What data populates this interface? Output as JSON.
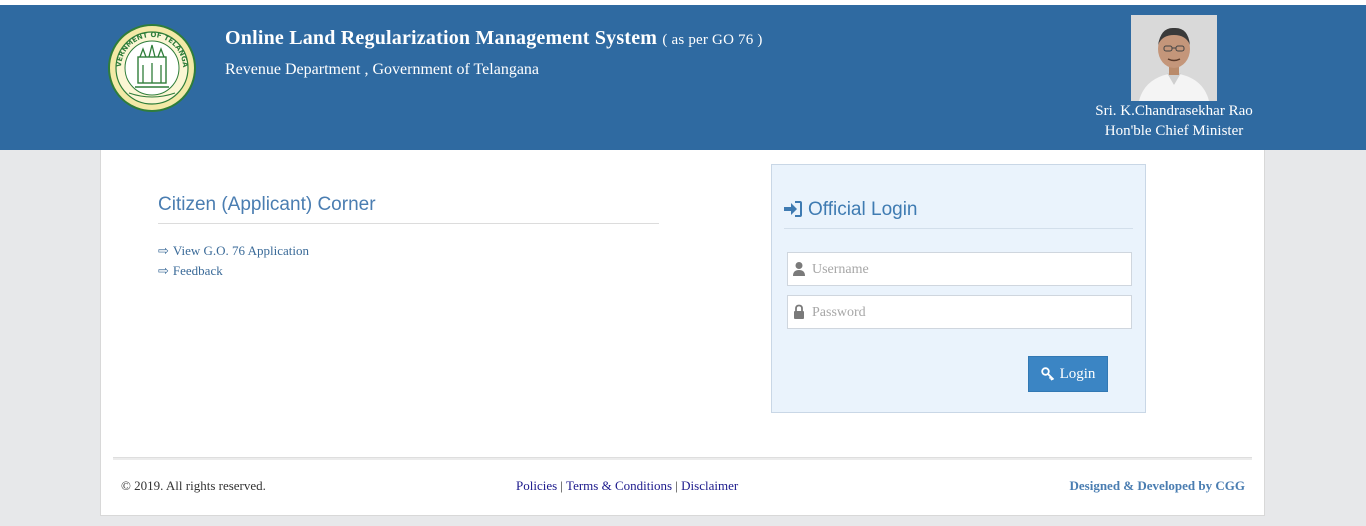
{
  "header": {
    "title": "Online Land Regularization Management System",
    "title_suffix": "( as per GO 76 )",
    "department": "Revenue Department , Government of Telangana",
    "emblem_text": "GOVERNMENT OF TELANGANA",
    "cm_name": "Sri. K.Chandrasekhar Rao",
    "cm_title": "Hon'ble Chief Minister"
  },
  "citizen": {
    "title": "Citizen (Applicant) Corner",
    "links": [
      {
        "arrow": "⇨",
        "label": "View G.O. 76 Application"
      },
      {
        "arrow": "⇨",
        "label": "Feedback"
      }
    ]
  },
  "login": {
    "title": "Official Login",
    "username_placeholder": "Username",
    "password_placeholder": "Password",
    "button_label": "Login"
  },
  "footer": {
    "copyright": "© 2019. All rights reserved.",
    "links": [
      "Policies",
      "Terms & Conditions",
      "Disclaimer"
    ],
    "separator": "|",
    "designed_by": "Designed & Developed by CGG"
  },
  "colors": {
    "header_bg": "#2f6aa1",
    "accent": "#4a7db1",
    "login_button": "#3b85c4",
    "login_panel_bg": "#eaf3fc"
  },
  "icons": {
    "login_title": "sign-in-icon",
    "username": "user-icon",
    "password": "lock-icon",
    "login_button": "key-icon"
  }
}
